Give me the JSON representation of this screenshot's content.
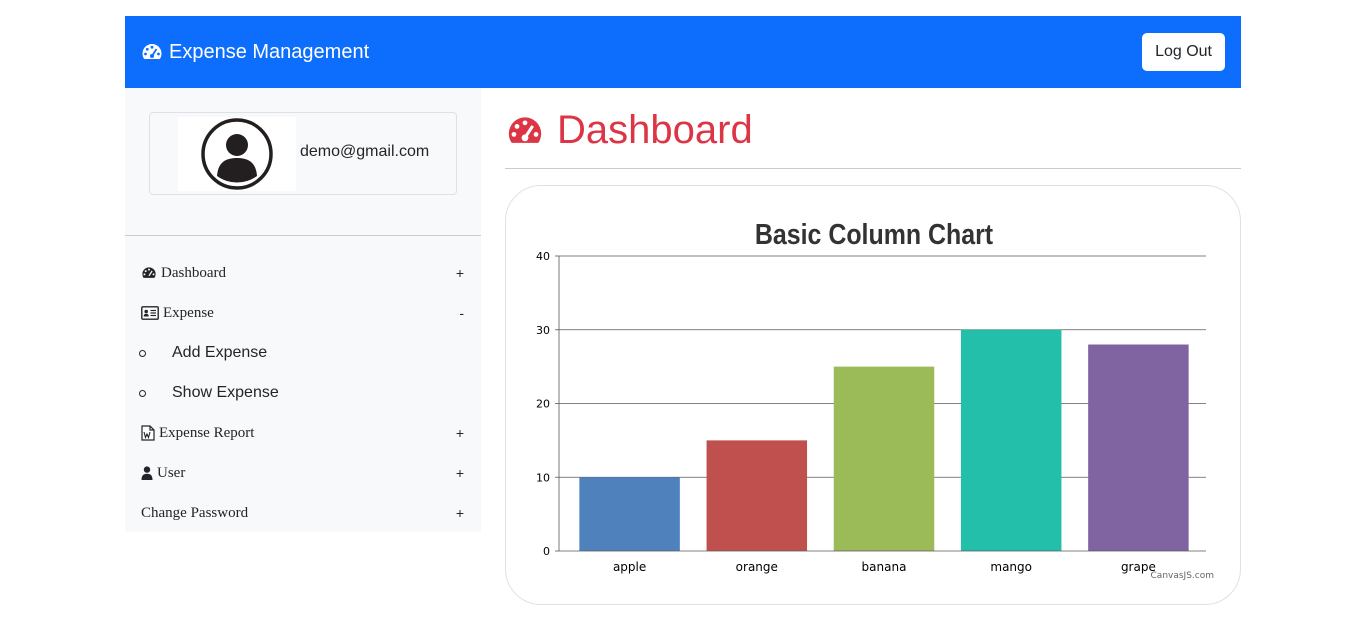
{
  "navbar": {
    "brand": "Expense Management",
    "logout_label": "Log Out",
    "brand_color": "#0d6efd"
  },
  "profile": {
    "email": "demo@gmail.com",
    "avatar_icon": "user-circle-icon"
  },
  "sidebar": {
    "items": [
      {
        "label": "Dashboard",
        "toggle": "+",
        "icon": "dashboard-icon"
      },
      {
        "label": "Expense",
        "toggle": "-",
        "icon": "id-card-icon"
      },
      {
        "label": "Expense Report",
        "toggle": "+",
        "icon": "word-file-icon"
      },
      {
        "label": "User",
        "toggle": "+",
        "icon": "user-icon"
      },
      {
        "label": "Change Password",
        "toggle": "+"
      }
    ],
    "expense_submenu": [
      "Add Expense",
      "Show Expense"
    ]
  },
  "page": {
    "title": "Dashboard",
    "title_color": "#dc3545"
  },
  "chart_data": {
    "type": "bar",
    "title": "Basic Column Chart",
    "categories": [
      "apple",
      "orange",
      "banana",
      "mango",
      "grape"
    ],
    "values": [
      10,
      15,
      25,
      30,
      28
    ],
    "colors": [
      "#4f81bc",
      "#c0504e",
      "#9bbb58",
      "#23bfaa",
      "#8064a1"
    ],
    "ylim": [
      0,
      40
    ],
    "yticks": [
      0,
      10,
      20,
      30,
      40
    ],
    "grid": true,
    "credit": "CanvasJS.com"
  }
}
